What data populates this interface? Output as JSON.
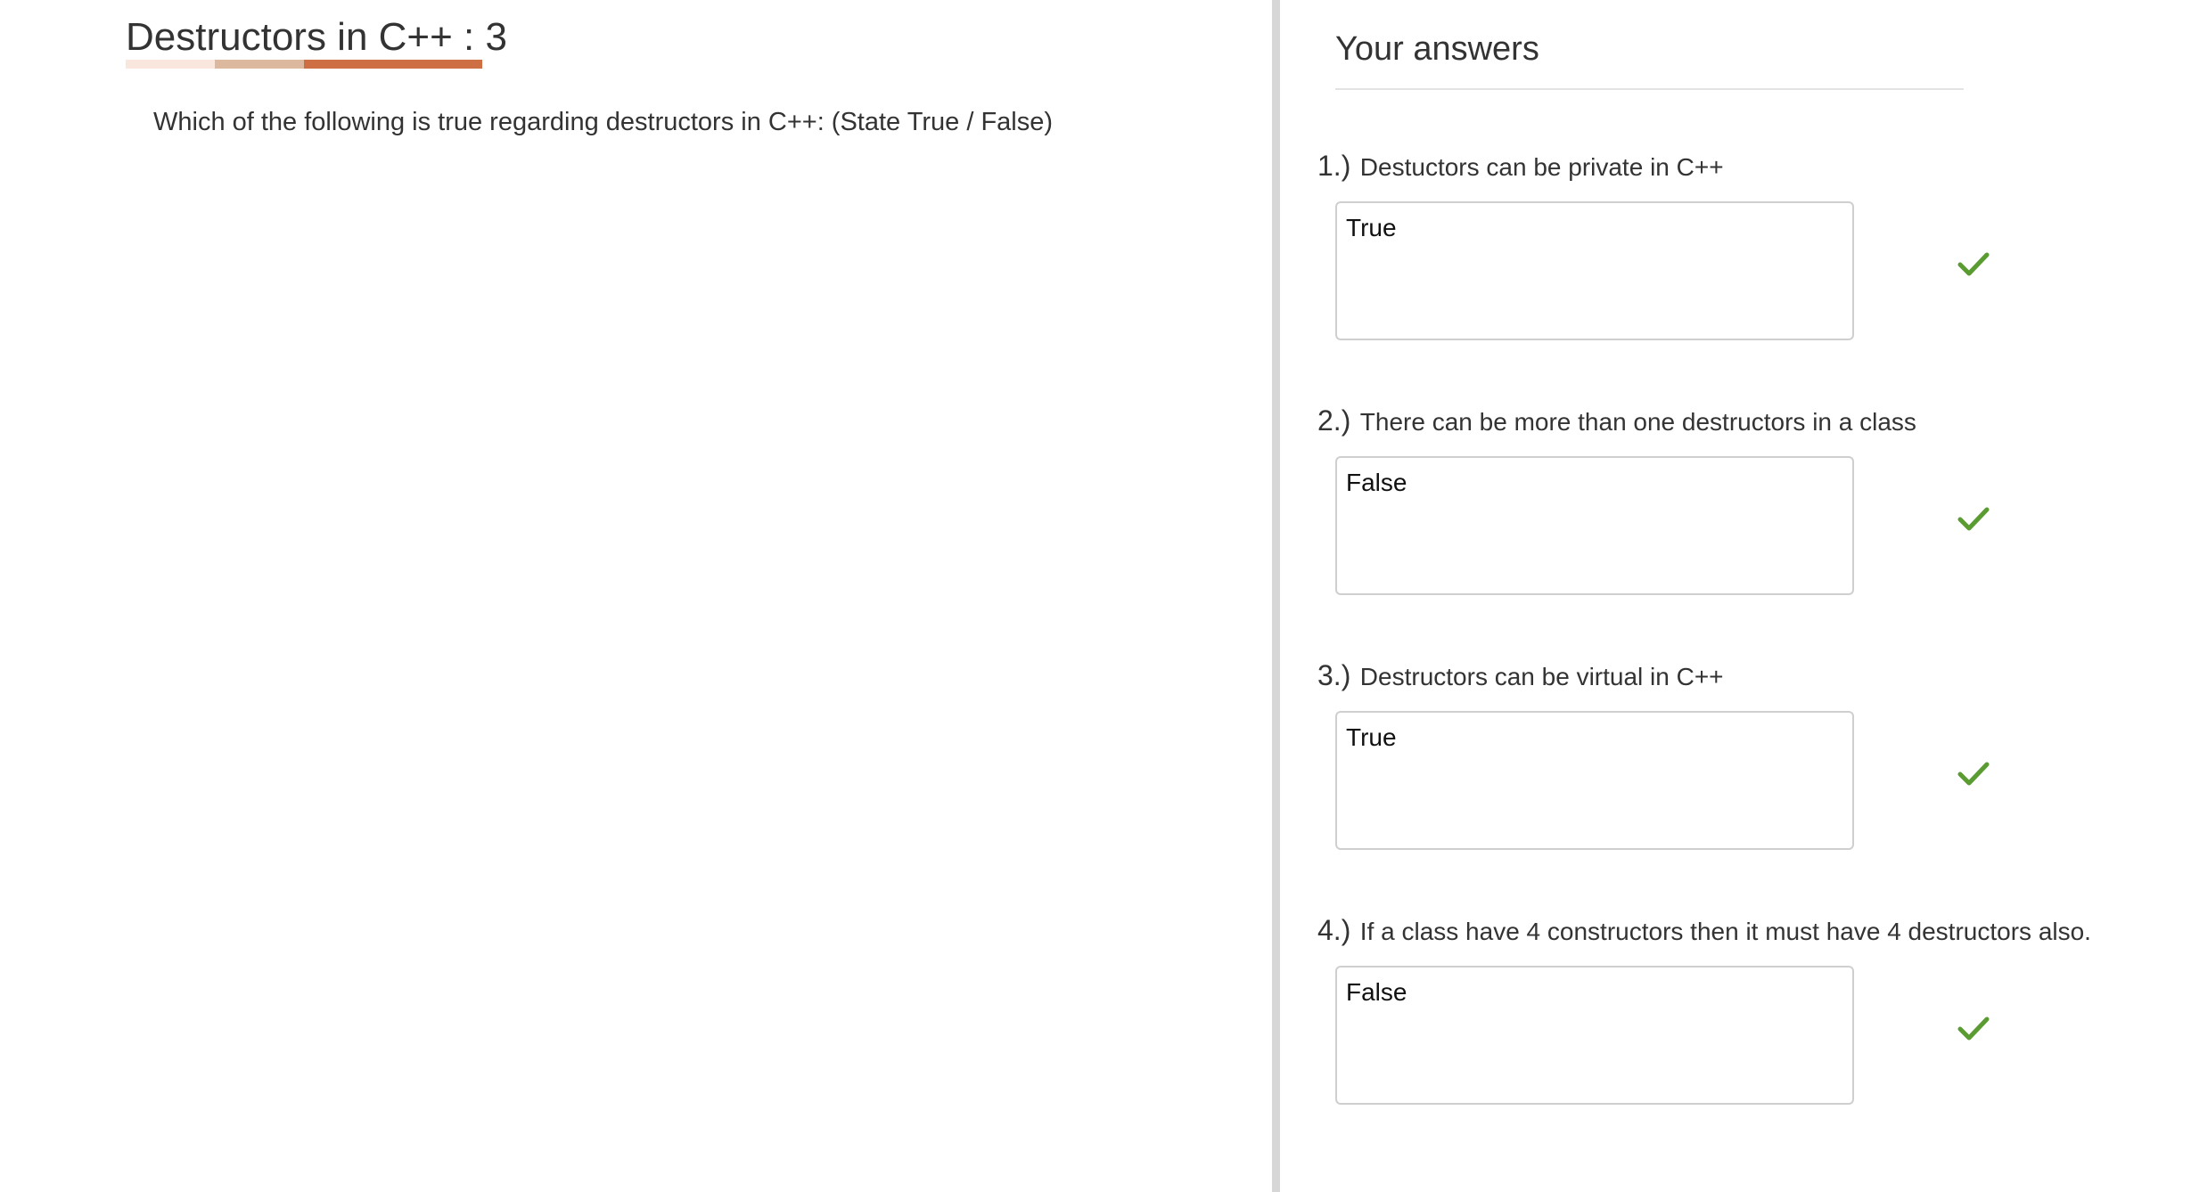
{
  "quiz": {
    "title": "Destructors in C++ : 3",
    "question": "Which of the following is true regarding destructors in C++: (State True / False)",
    "underline_colors": [
      "#f9e6dc",
      "#dcb89e",
      "#cd6e43"
    ]
  },
  "answers_panel": {
    "title": "Your answers",
    "check_color": "#5a9b32",
    "items": [
      {
        "number": "1.)",
        "question": "Destuctors can be private in C++",
        "answer": "True",
        "status_icon": "check-icon"
      },
      {
        "number": "2.)",
        "question": "There can be more than one destructors in a class",
        "answer": "False",
        "status_icon": "check-icon"
      },
      {
        "number": "3.)",
        "question": "Destructors can be virtual in C++",
        "answer": "True",
        "status_icon": "check-icon"
      },
      {
        "number": "4.)",
        "question": "If a class have 4 constructors then it must have 4 destructors also.",
        "answer": "False",
        "status_icon": "check-icon"
      }
    ]
  }
}
